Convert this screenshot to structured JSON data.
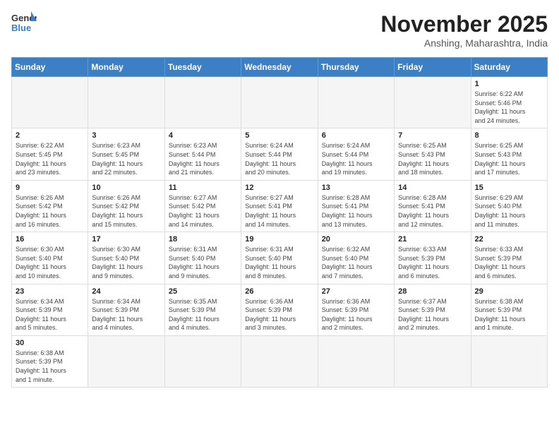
{
  "header": {
    "logo_general": "General",
    "logo_blue": "Blue",
    "month_title": "November 2025",
    "location": "Anshing, Maharashtra, India"
  },
  "days_of_week": [
    "Sunday",
    "Monday",
    "Tuesday",
    "Wednesday",
    "Thursday",
    "Friday",
    "Saturday"
  ],
  "weeks": [
    [
      {
        "day": "",
        "info": ""
      },
      {
        "day": "",
        "info": ""
      },
      {
        "day": "",
        "info": ""
      },
      {
        "day": "",
        "info": ""
      },
      {
        "day": "",
        "info": ""
      },
      {
        "day": "",
        "info": ""
      },
      {
        "day": "1",
        "info": "Sunrise: 6:22 AM\nSunset: 5:46 PM\nDaylight: 11 hours\nand 24 minutes."
      }
    ],
    [
      {
        "day": "2",
        "info": "Sunrise: 6:22 AM\nSunset: 5:45 PM\nDaylight: 11 hours\nand 23 minutes."
      },
      {
        "day": "3",
        "info": "Sunrise: 6:23 AM\nSunset: 5:45 PM\nDaylight: 11 hours\nand 22 minutes."
      },
      {
        "day": "4",
        "info": "Sunrise: 6:23 AM\nSunset: 5:44 PM\nDaylight: 11 hours\nand 21 minutes."
      },
      {
        "day": "5",
        "info": "Sunrise: 6:24 AM\nSunset: 5:44 PM\nDaylight: 11 hours\nand 20 minutes."
      },
      {
        "day": "6",
        "info": "Sunrise: 6:24 AM\nSunset: 5:44 PM\nDaylight: 11 hours\nand 19 minutes."
      },
      {
        "day": "7",
        "info": "Sunrise: 6:25 AM\nSunset: 5:43 PM\nDaylight: 11 hours\nand 18 minutes."
      },
      {
        "day": "8",
        "info": "Sunrise: 6:25 AM\nSunset: 5:43 PM\nDaylight: 11 hours\nand 17 minutes."
      }
    ],
    [
      {
        "day": "9",
        "info": "Sunrise: 6:26 AM\nSunset: 5:42 PM\nDaylight: 11 hours\nand 16 minutes."
      },
      {
        "day": "10",
        "info": "Sunrise: 6:26 AM\nSunset: 5:42 PM\nDaylight: 11 hours\nand 15 minutes."
      },
      {
        "day": "11",
        "info": "Sunrise: 6:27 AM\nSunset: 5:42 PM\nDaylight: 11 hours\nand 14 minutes."
      },
      {
        "day": "12",
        "info": "Sunrise: 6:27 AM\nSunset: 5:41 PM\nDaylight: 11 hours\nand 14 minutes."
      },
      {
        "day": "13",
        "info": "Sunrise: 6:28 AM\nSunset: 5:41 PM\nDaylight: 11 hours\nand 13 minutes."
      },
      {
        "day": "14",
        "info": "Sunrise: 6:28 AM\nSunset: 5:41 PM\nDaylight: 11 hours\nand 12 minutes."
      },
      {
        "day": "15",
        "info": "Sunrise: 6:29 AM\nSunset: 5:40 PM\nDaylight: 11 hours\nand 11 minutes."
      }
    ],
    [
      {
        "day": "16",
        "info": "Sunrise: 6:30 AM\nSunset: 5:40 PM\nDaylight: 11 hours\nand 10 minutes."
      },
      {
        "day": "17",
        "info": "Sunrise: 6:30 AM\nSunset: 5:40 PM\nDaylight: 11 hours\nand 9 minutes."
      },
      {
        "day": "18",
        "info": "Sunrise: 6:31 AM\nSunset: 5:40 PM\nDaylight: 11 hours\nand 9 minutes."
      },
      {
        "day": "19",
        "info": "Sunrise: 6:31 AM\nSunset: 5:40 PM\nDaylight: 11 hours\nand 8 minutes."
      },
      {
        "day": "20",
        "info": "Sunrise: 6:32 AM\nSunset: 5:40 PM\nDaylight: 11 hours\nand 7 minutes."
      },
      {
        "day": "21",
        "info": "Sunrise: 6:33 AM\nSunset: 5:39 PM\nDaylight: 11 hours\nand 6 minutes."
      },
      {
        "day": "22",
        "info": "Sunrise: 6:33 AM\nSunset: 5:39 PM\nDaylight: 11 hours\nand 6 minutes."
      }
    ],
    [
      {
        "day": "23",
        "info": "Sunrise: 6:34 AM\nSunset: 5:39 PM\nDaylight: 11 hours\nand 5 minutes."
      },
      {
        "day": "24",
        "info": "Sunrise: 6:34 AM\nSunset: 5:39 PM\nDaylight: 11 hours\nand 4 minutes."
      },
      {
        "day": "25",
        "info": "Sunrise: 6:35 AM\nSunset: 5:39 PM\nDaylight: 11 hours\nand 4 minutes."
      },
      {
        "day": "26",
        "info": "Sunrise: 6:36 AM\nSunset: 5:39 PM\nDaylight: 11 hours\nand 3 minutes."
      },
      {
        "day": "27",
        "info": "Sunrise: 6:36 AM\nSunset: 5:39 PM\nDaylight: 11 hours\nand 2 minutes."
      },
      {
        "day": "28",
        "info": "Sunrise: 6:37 AM\nSunset: 5:39 PM\nDaylight: 11 hours\nand 2 minutes."
      },
      {
        "day": "29",
        "info": "Sunrise: 6:38 AM\nSunset: 5:39 PM\nDaylight: 11 hours\nand 1 minute."
      }
    ],
    [
      {
        "day": "30",
        "info": "Sunrise: 6:38 AM\nSunset: 5:39 PM\nDaylight: 11 hours\nand 1 minute."
      },
      {
        "day": "",
        "info": ""
      },
      {
        "day": "",
        "info": ""
      },
      {
        "day": "",
        "info": ""
      },
      {
        "day": "",
        "info": ""
      },
      {
        "day": "",
        "info": ""
      },
      {
        "day": "",
        "info": ""
      }
    ]
  ]
}
